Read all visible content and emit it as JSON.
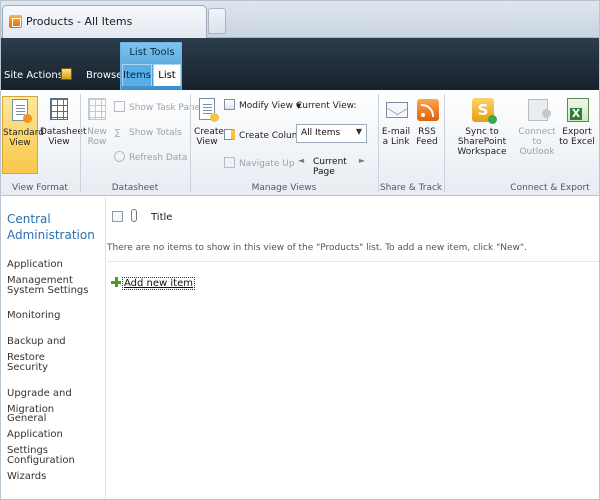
{
  "browser": {
    "tab_title": "Products - All Items"
  },
  "ribbon_header": {
    "site_actions": "Site Actions",
    "browse_tab": "Browse",
    "context_group": "List Tools",
    "tabs": [
      "Items",
      "List"
    ],
    "active_tab": "List"
  },
  "ribbon": {
    "view_format": {
      "label": "View Format",
      "standard_view": "Standard View",
      "datasheet_view": "Datasheet View"
    },
    "datasheet": {
      "label": "Datasheet",
      "new_row": "New Row",
      "show_task_pane": "Show Task Pane",
      "show_totals": "Show Totals",
      "refresh_data": "Refresh Data"
    },
    "manage_views": {
      "label": "Manage Views",
      "create_view": "Create View",
      "modify_view": "Modify View",
      "create_column": "Create Column",
      "navigate_up": "Navigate Up",
      "current_view_label": "Current View:",
      "current_view_value": "All Items",
      "current_page": "Current Page"
    },
    "share_track": {
      "label": "Share & Track",
      "email_link": "E-mail a Link",
      "rss_feed": "RSS Feed"
    },
    "connect_export": {
      "label": "Connect & Export",
      "sync": "Sync to SharePoint Workspace",
      "connect_outlook": "Connect to Outlook",
      "export_excel": "Export to Excel"
    }
  },
  "left_nav": {
    "heading": "Central Administration",
    "items": [
      "Application Management",
      "System Settings",
      "Monitoring",
      "Backup and Restore",
      "Security",
      "Upgrade and Migration",
      "General Application Settings",
      "Configuration Wizards"
    ]
  },
  "list": {
    "column_title": "Title",
    "empty_message": "There are no items to show in this view of the \"Products\" list. To add a new item, click \"New\".",
    "add_new_item": "Add new item"
  },
  "colors": {
    "ribbon_dark": "#1f2c39",
    "context_blue": "#5aaee6",
    "selected_button": "#f7c84a",
    "nav_heading": "#2a6fb0"
  }
}
